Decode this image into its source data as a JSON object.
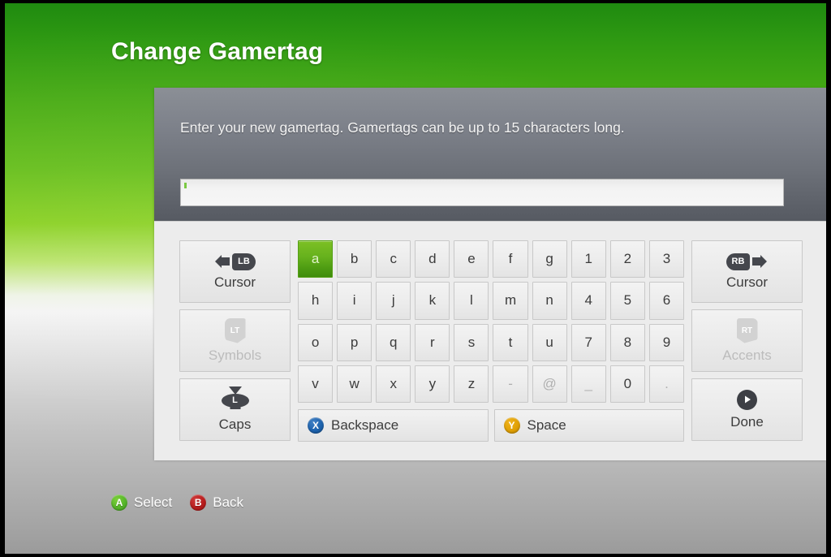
{
  "title": "Change Gamertag",
  "dialog": {
    "prompt": "Enter your new gamertag. Gamertags can be up to 15 characters long.",
    "input": {
      "value": "",
      "placeholder": ""
    }
  },
  "left_buttons": [
    {
      "label": "Cursor",
      "glyph": "lb-left-arrow-icon",
      "badge": "LB",
      "disabled": false
    },
    {
      "label": "Symbols",
      "glyph": "lt-trigger-icon",
      "badge": "LT",
      "disabled": true
    },
    {
      "label": "Caps",
      "glyph": "left-stick-up-icon",
      "badge": "L",
      "disabled": false
    }
  ],
  "right_buttons": [
    {
      "label": "Cursor",
      "glyph": "rb-right-arrow-icon",
      "badge": "RB",
      "disabled": false
    },
    {
      "label": "Accents",
      "glyph": "rt-trigger-icon",
      "badge": "RT",
      "disabled": true
    },
    {
      "label": "Done",
      "glyph": "start-button-icon",
      "badge": "",
      "disabled": false
    }
  ],
  "keyboard": {
    "selected_key": "a",
    "rows": [
      [
        "a",
        "b",
        "c",
        "d",
        "e",
        "f",
        "g",
        "1",
        "2",
        "3"
      ],
      [
        "h",
        "i",
        "j",
        "k",
        "l",
        "m",
        "n",
        "4",
        "5",
        "6"
      ],
      [
        "o",
        "p",
        "q",
        "r",
        "s",
        "t",
        "u",
        "7",
        "8",
        "9"
      ],
      [
        "v",
        "w",
        "x",
        "y",
        "z",
        "-",
        "@",
        "_",
        "0",
        "."
      ]
    ],
    "punctuation_keys": [
      "-",
      "@",
      "_",
      "."
    ]
  },
  "actions": [
    {
      "label": "Backspace",
      "button": "X",
      "color": "#1d62ad"
    },
    {
      "label": "Space",
      "button": "Y",
      "color": "#e0a004"
    }
  ],
  "legend": [
    {
      "label": "Select",
      "button": "A",
      "color": "#56b52a"
    },
    {
      "label": "Back",
      "button": "B",
      "color": "#b81d1d"
    }
  ],
  "colors": {
    "brand_green": "#66b11d",
    "selected_key": "#4e9c12",
    "panel_header": "#6d7179",
    "panel_body": "#ececec"
  }
}
